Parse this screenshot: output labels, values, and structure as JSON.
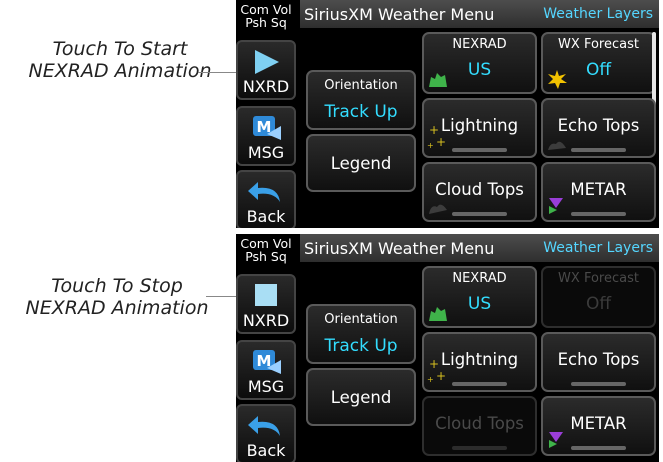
{
  "callouts": {
    "top": [
      "Touch To Start",
      "NEXRAD Animation"
    ],
    "bottom": [
      "Touch To Stop",
      "NEXRAD Animation"
    ]
  },
  "screens": [
    {
      "side": {
        "com_vol": "Com Vol",
        "psh_sq": "Psh Sq",
        "nxrd": "NXRD",
        "msg": "MSG",
        "back": "Back"
      },
      "title": "SiriusXM Weather Menu",
      "layers_label": "Weather Layers",
      "orientation": {
        "caption": "Orientation",
        "value": "Track Up"
      },
      "legend": "Legend",
      "nexrad": {
        "caption": "NEXRAD",
        "value": "US"
      },
      "wx_forecast": {
        "caption": "WX Forecast",
        "value": "Off"
      },
      "lightning": "Lightning",
      "echo_tops": "Echo Tops",
      "cloud_tops": "Cloud Tops",
      "metar": "METAR",
      "nxrd_state": "play"
    },
    {
      "side": {
        "com_vol": "Com Vol",
        "psh_sq": "Psh Sq",
        "nxrd": "NXRD",
        "msg": "MSG",
        "back": "Back"
      },
      "title": "SiriusXM Weather Menu",
      "layers_label": "Weather Layers",
      "orientation": {
        "caption": "Orientation",
        "value": "Track Up"
      },
      "legend": "Legend",
      "nexrad": {
        "caption": "NEXRAD",
        "value": "US"
      },
      "wx_forecast": {
        "caption": "WX Forecast",
        "value": "Off"
      },
      "lightning": "Lightning",
      "echo_tops": "Echo Tops",
      "cloud_tops": "Cloud Tops",
      "metar": "METAR",
      "nxrd_state": "stop"
    }
  ],
  "colors": {
    "accent": "#33ddff",
    "title_accent": "#55d6ff",
    "nexrad_icon": "#3fb34a",
    "forecast_icon": "#f2c200",
    "lightning_icon": "#d8c020",
    "metar_icon": "#9a3ed8"
  }
}
